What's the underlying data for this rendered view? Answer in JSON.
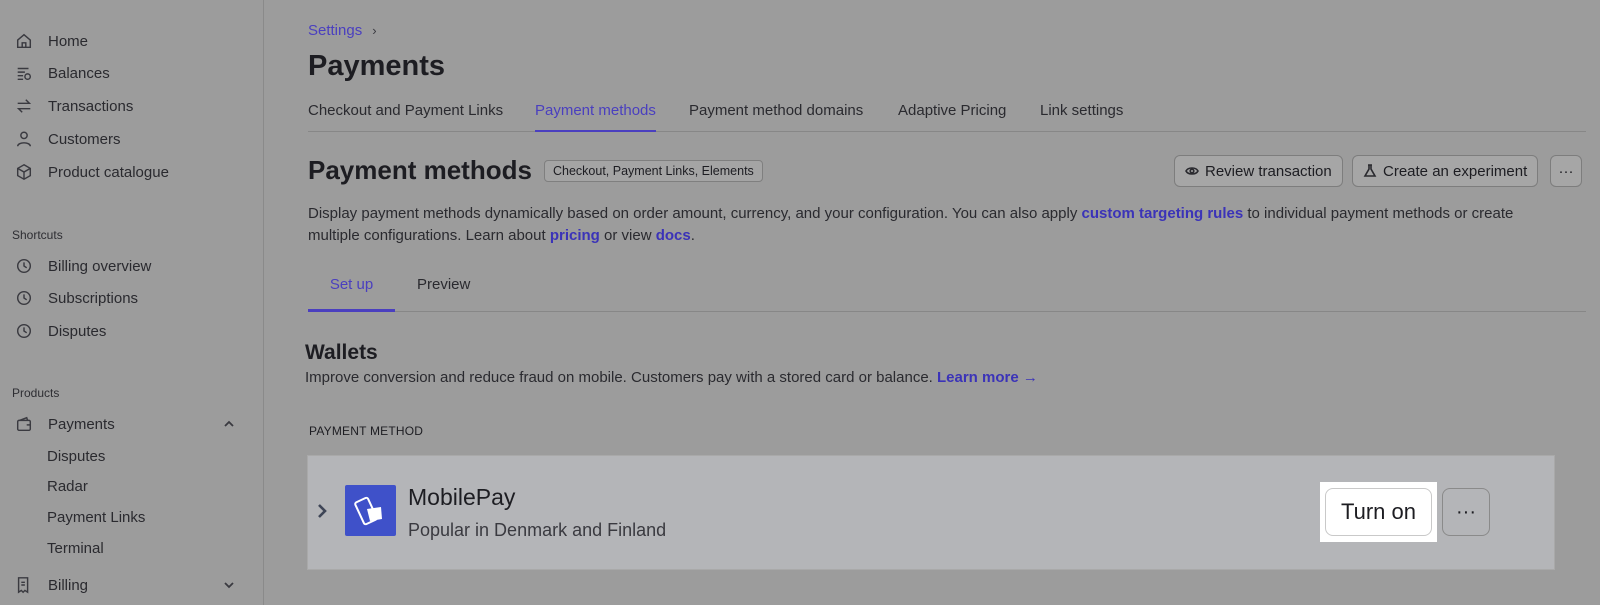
{
  "sidebar": {
    "nav": [
      {
        "label": "Home",
        "icon": "home-icon"
      },
      {
        "label": "Balances",
        "icon": "balances-icon"
      },
      {
        "label": "Transactions",
        "icon": "transactions-icon"
      },
      {
        "label": "Customers",
        "icon": "user-icon"
      },
      {
        "label": "Product catalogue",
        "icon": "box-icon"
      }
    ],
    "shortcuts_label": "Shortcuts",
    "shortcuts": [
      {
        "label": "Billing overview",
        "icon": "clock-icon"
      },
      {
        "label": "Subscriptions",
        "icon": "clock-icon"
      },
      {
        "label": "Disputes",
        "icon": "clock-icon"
      }
    ],
    "products_label": "Products",
    "payments_label": "Payments",
    "payments_sub": [
      "Disputes",
      "Radar",
      "Payment Links",
      "Terminal"
    ],
    "billing_label": "Billing"
  },
  "breadcrumb": {
    "label": "Settings",
    "sep": "›"
  },
  "page_title": "Payments",
  "tabs": [
    "Checkout and Payment Links",
    "Payment methods",
    "Payment method domains",
    "Adaptive Pricing",
    "Link settings"
  ],
  "section": {
    "title": "Payment methods",
    "pill": "Checkout, Payment Links, Elements",
    "review_label": "Review transaction",
    "experiment_label": "Create an experiment",
    "more_label": "···",
    "desc_1": "Display payment methods dynamically based on order amount, currency, and your configuration. You can also apply ",
    "desc_link_1": "custom targeting rules",
    "desc_2": " to individual payment methods or create multiple configurations. Learn about ",
    "desc_link_2": "pricing",
    "desc_3": " or view ",
    "desc_link_3": "docs",
    "desc_4": "."
  },
  "subtabs": [
    "Set up",
    "Preview"
  ],
  "wallets": {
    "title": "Wallets",
    "desc": "Improve conversion and reduce fraud on mobile. Customers pay with a stored card or balance. ",
    "learn_more": "Learn more →",
    "column_header": "PAYMENT METHOD"
  },
  "payment_method": {
    "name": "MobilePay",
    "subtitle": "Popular in Denmark and Finland",
    "turn_on_label": "Turn on",
    "more_label": "···",
    "logo_color": "#3f51c9"
  },
  "colors": {
    "accent": "#4a3fbf",
    "link": "#3b33b8"
  }
}
